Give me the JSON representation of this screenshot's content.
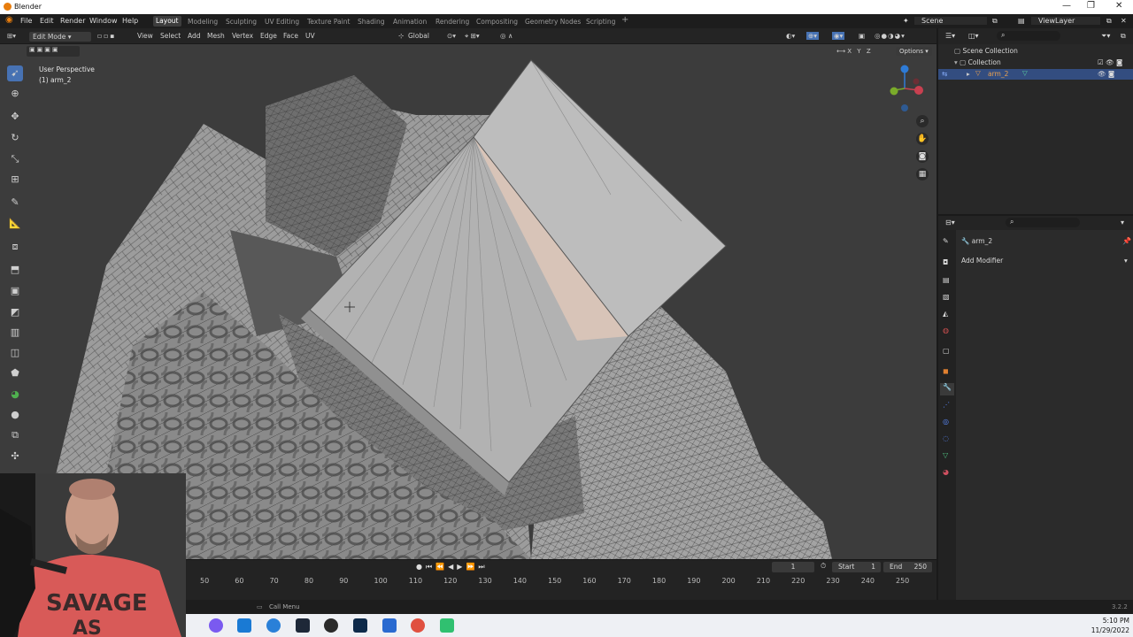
{
  "window": {
    "title": "Blender",
    "controls": [
      "—",
      "❐",
      "✕"
    ]
  },
  "menubar": {
    "items": [
      "File",
      "Edit",
      "Render",
      "Window",
      "Help"
    ]
  },
  "workspaces": [
    "Layout",
    "Modeling",
    "Sculpting",
    "UV Editing",
    "Texture Paint",
    "Shading",
    "Animation",
    "Rendering",
    "Compositing",
    "Geometry Nodes",
    "Scripting"
  ],
  "active_workspace": "Layout",
  "scene": {
    "name": "Scene",
    "view_layer": "ViewLayer"
  },
  "header": {
    "mode": "Edit Mode",
    "menus": [
      "View",
      "Select",
      "Add",
      "Mesh",
      "Vertex",
      "Edge",
      "Face",
      "UV"
    ],
    "orientation": "Global",
    "options_label": "Options",
    "axes": [
      "X",
      "Y",
      "Z"
    ]
  },
  "viewport": {
    "perspective": "User Perspective",
    "object": "(1) arm_2"
  },
  "outliner": {
    "scene_collection": "Scene Collection",
    "collection": "Collection",
    "object": "arm_2"
  },
  "properties": {
    "object_name": "arm_2",
    "add_modifier": "Add Modifier"
  },
  "timeline": {
    "current_frame": "1",
    "start_label": "Start",
    "start_value": "1",
    "end_label": "End",
    "end_value": "250",
    "ticks": [
      "50",
      "60",
      "70",
      "80",
      "90",
      "100",
      "110",
      "120",
      "130",
      "140",
      "150",
      "160",
      "170",
      "180",
      "190",
      "200",
      "210",
      "220",
      "230",
      "240",
      "250"
    ]
  },
  "statusbar": {
    "hint": "Call Menu",
    "version": "3.2.2"
  },
  "taskbar": {
    "time": "5:10 PM",
    "date": "11/29/2022"
  },
  "webcam": {
    "shirt_text_1": "SAVAGE",
    "shirt_text_2": "AS"
  },
  "colors": {
    "accent": "#4772b3",
    "selected_face": "#d8c4b8",
    "mesh": "#9a9a9a",
    "highlight": "#e87d0d"
  }
}
